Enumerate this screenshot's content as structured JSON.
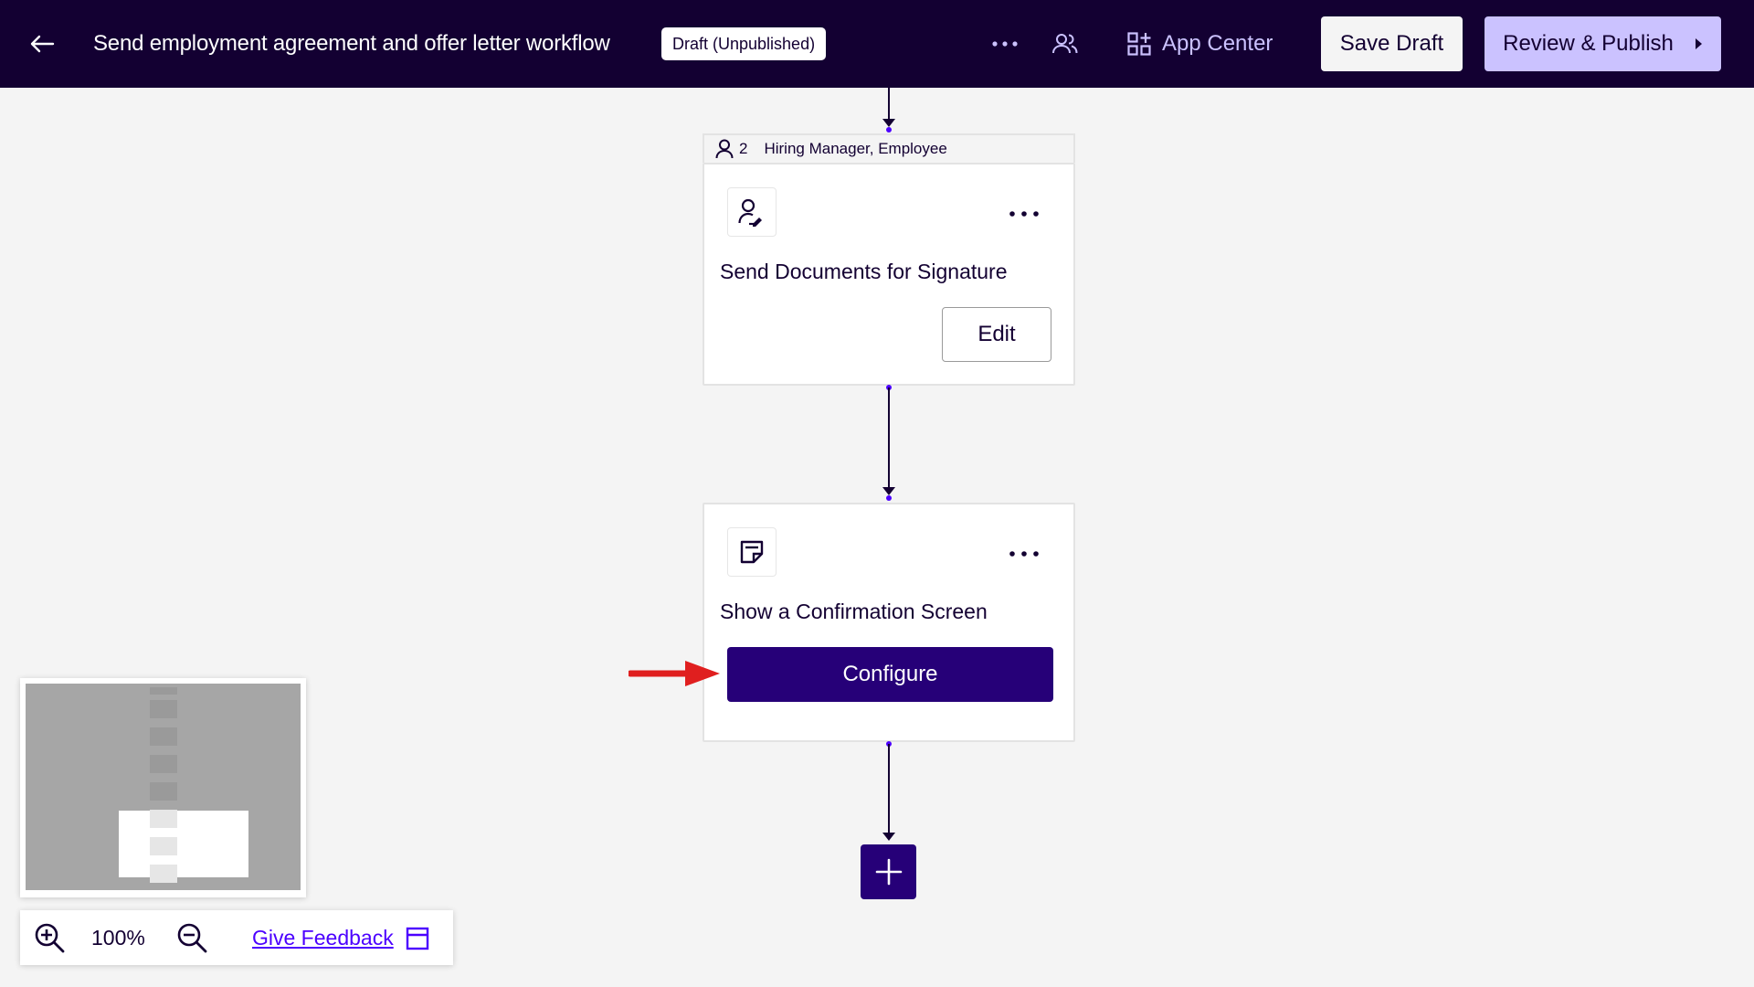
{
  "header": {
    "title": "Send employment agreement and offer letter workflow",
    "status_badge": "Draft (Unpublished)",
    "app_center_label": "App Center",
    "save_draft_label": "Save Draft",
    "publish_label": "Review & Publish"
  },
  "steps": [
    {
      "assignee_count": "2",
      "assignees": "Hiring Manager, Employee",
      "icon": "person-signature-icon",
      "title": "Send Documents for Signature",
      "action_label": "Edit"
    },
    {
      "icon": "confirmation-screen-icon",
      "title": "Show a Confirmation Screen",
      "action_label": "Configure"
    }
  ],
  "zoom": {
    "level": "100%",
    "feedback_label": "Give Feedback"
  },
  "colors": {
    "header_bg": "#130032",
    "primary": "#260078",
    "publish_bg": "#cbc2ff",
    "link": "#4c00ff",
    "annotation_arrow": "#e01f1f"
  }
}
